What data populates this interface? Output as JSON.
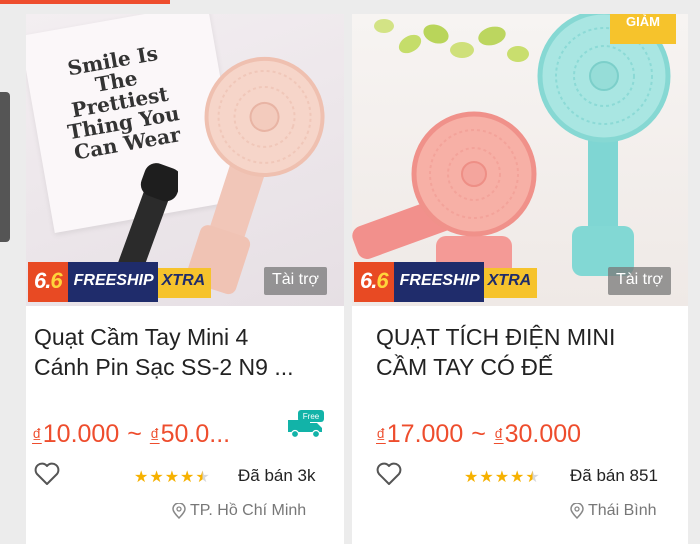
{
  "colors": {
    "accent": "#ee4d2d",
    "star": "#f6b100",
    "badge_navy": "#1f2c6b",
    "badge_yellow": "#f6c32c"
  },
  "products": [
    {
      "poster_text": "Smile Is The Prettiest Thing You Can Wear",
      "badge_66": "6.6",
      "badge_freeship": "FREESHIP",
      "badge_xtra": "XTRA",
      "sponsor": "Tài trợ",
      "title_line1": "Quạt Cầm Tay Mini 4",
      "title_line2": "Cánh Pin Sạc SS-2 N9 ...",
      "price_min": "10.000",
      "price_max": "50.0...",
      "currency": "₫",
      "price_sep": "~",
      "free_ship_label": "Free",
      "rating": 4.5,
      "sold": "Đã bán 3k",
      "location": "TP. Hồ Chí Minh"
    },
    {
      "discount_tag": "GIẢM",
      "badge_66": "6.6",
      "badge_freeship": "FREESHIP",
      "badge_xtra": "XTRA",
      "sponsor": "Tài trợ",
      "title_line1": "QUẠT TÍCH ĐIỆN MINI",
      "title_line2": "CẦM TAY CÓ ĐẾ",
      "price_min": "17.000",
      "price_max": "30.000",
      "currency": "₫",
      "price_sep": "~",
      "rating": 4.5,
      "sold": "Đã bán 851",
      "location": "Thái Bình"
    }
  ]
}
